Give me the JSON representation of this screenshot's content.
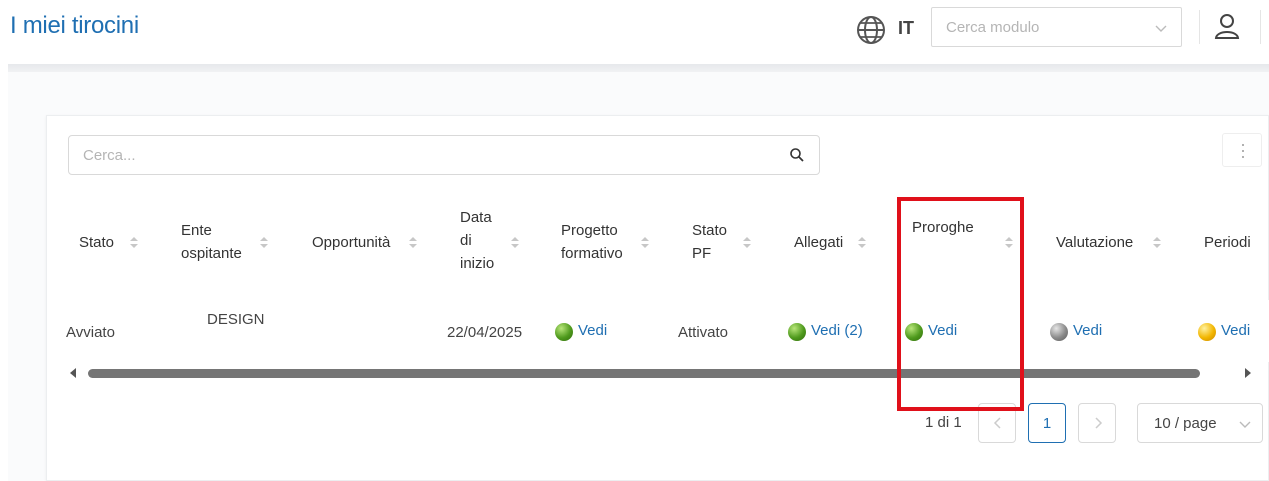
{
  "header": {
    "title": "I miei tirocini",
    "language": "IT",
    "module_search_placeholder": "Cerca modulo"
  },
  "search": {
    "placeholder": "Cerca..."
  },
  "table": {
    "columns": [
      {
        "label": "Stato"
      },
      {
        "label_lines": [
          "Ente",
          "ospitante"
        ]
      },
      {
        "label": "Opportunità"
      },
      {
        "label_lines": [
          "Data",
          "di",
          "inizio"
        ]
      },
      {
        "label_lines": [
          "Progetto",
          "formativo"
        ]
      },
      {
        "label_lines": [
          "Stato",
          "PF"
        ]
      },
      {
        "label": "Allegati"
      },
      {
        "label": "Proroghe"
      },
      {
        "label": "Valutazione"
      },
      {
        "label": "Periodi"
      }
    ],
    "rows": [
      {
        "stato": "Avviato",
        "ente": "DESIGN",
        "opportunita": "",
        "data_inizio": "22/04/2025",
        "progetto": {
          "text": "Vedi",
          "status_color": "green"
        },
        "stato_pf": "Attivato",
        "allegati": {
          "text": "Vedi (2)",
          "status_color": "green"
        },
        "proroghe": {
          "text": "Vedi",
          "status_color": "green"
        },
        "valutazione": {
          "text": "Vedi",
          "status_color": "gray"
        },
        "periodi": {
          "text": "Vedi",
          "status_color": "yellow"
        }
      }
    ]
  },
  "pagination": {
    "info": "1 di 1",
    "current_page": "1",
    "page_size": "10 / page"
  },
  "colors": {
    "accent": "#1f6fb2",
    "highlight_box": "#e0101a"
  }
}
